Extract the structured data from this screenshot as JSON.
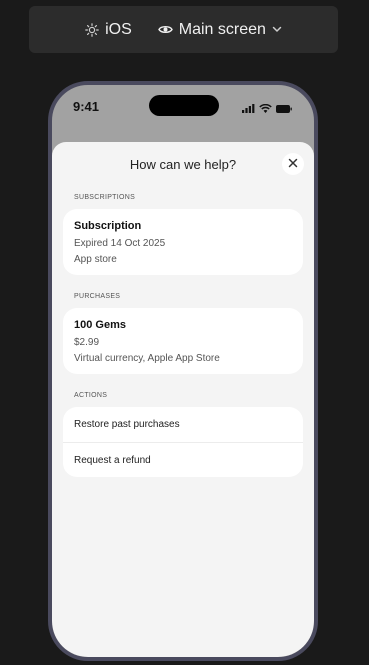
{
  "toolbar": {
    "platform_label": "iOS",
    "screen_label": "Main screen"
  },
  "statusbar": {
    "time": "9:41"
  },
  "sheet": {
    "title": "How can we help?",
    "subscriptions": {
      "section_label": "SUBSCRIPTIONS",
      "title": "Subscription",
      "status": "Expired 14 Oct 2025",
      "store": "App store"
    },
    "purchases": {
      "section_label": "PURCHASES",
      "title": "100 Gems",
      "price": "$2.99",
      "description": "Virtual currency, Apple App Store"
    },
    "actions": {
      "section_label": "ACTIONS",
      "items": [
        {
          "label": "Restore past purchases"
        },
        {
          "label": "Request a refund"
        }
      ]
    }
  }
}
